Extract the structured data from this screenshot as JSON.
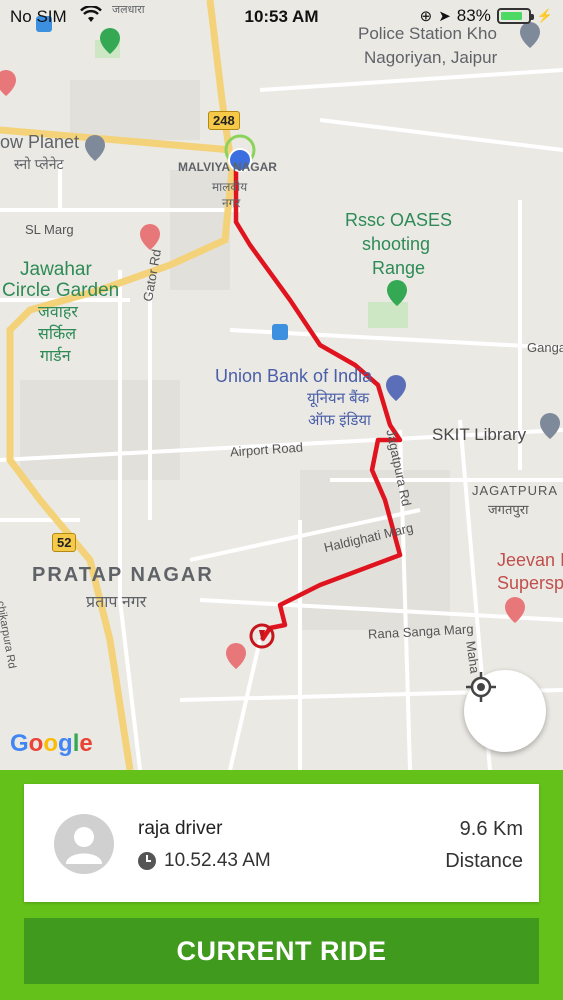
{
  "status_bar": {
    "carrier": "No SIM",
    "time": "10:53 AM",
    "battery": "83%",
    "battery_level": 0.83
  },
  "map": {
    "labels": {
      "police_station_line1": "Police Station Kho",
      "police_station_line2": "Nagoriyan, Jaipur",
      "ow_planet": "ow Planet",
      "ow_planet_hi": "स्नो प्लेनेट",
      "malviya_nagar_en": "MALVIYA NAGAR",
      "malviya_nagar_hi1": "मालवीय",
      "malviya_nagar_hi2": "नगर",
      "sl_marg": "SL Marg",
      "jawahar_line1": "Jawahar",
      "jawahar_line2": "Circle Garden",
      "jawahar_hi1": "जवाहर",
      "jawahar_hi2": "सर्किल",
      "jawahar_hi3": "गार्डन",
      "rssc_line1": "Rssc OASES",
      "rssc_line2": "shooting",
      "rssc_line3": "Range",
      "gator_rd": "Gator Rd",
      "ganga": "Ganga",
      "union_bank": "Union Bank of India",
      "union_bank_hi1": "यूनियन बैंक",
      "union_bank_hi2": "ऑफ इंडिया",
      "airport_road": "Airport Road",
      "skit_library": "SKIT Library",
      "jagatpura": "JAGATPURA",
      "jagatpura_hi": "जगतपुरा",
      "jagatpura_rd": "Jagatpura Rd",
      "haldighati": "Haldighati Marg",
      "pratap_nagar": "PRATAP NAGAR",
      "pratap_nagar_hi": "प्रताप नगर",
      "jeevan_line1": "Jeevan I",
      "jeevan_line2": "Supersp",
      "rana_sanga": "Rana Sanga Marg",
      "maha": "Maha",
      "top_hi": "जलधारा",
      "chikarpura": "chikarpura Rd"
    },
    "highways": {
      "h248": "248",
      "h52": "52"
    },
    "google_logo": "Google",
    "route_color": "#e0141e"
  },
  "ride": {
    "driver_name": "raja driver",
    "time": "10.52.43 AM",
    "distance_value": "9.6 Km",
    "distance_label": "Distance",
    "button_label": "CURRENT RIDE"
  },
  "colors": {
    "panel_green": "#64c11a",
    "button_green": "#3f9a1d"
  }
}
